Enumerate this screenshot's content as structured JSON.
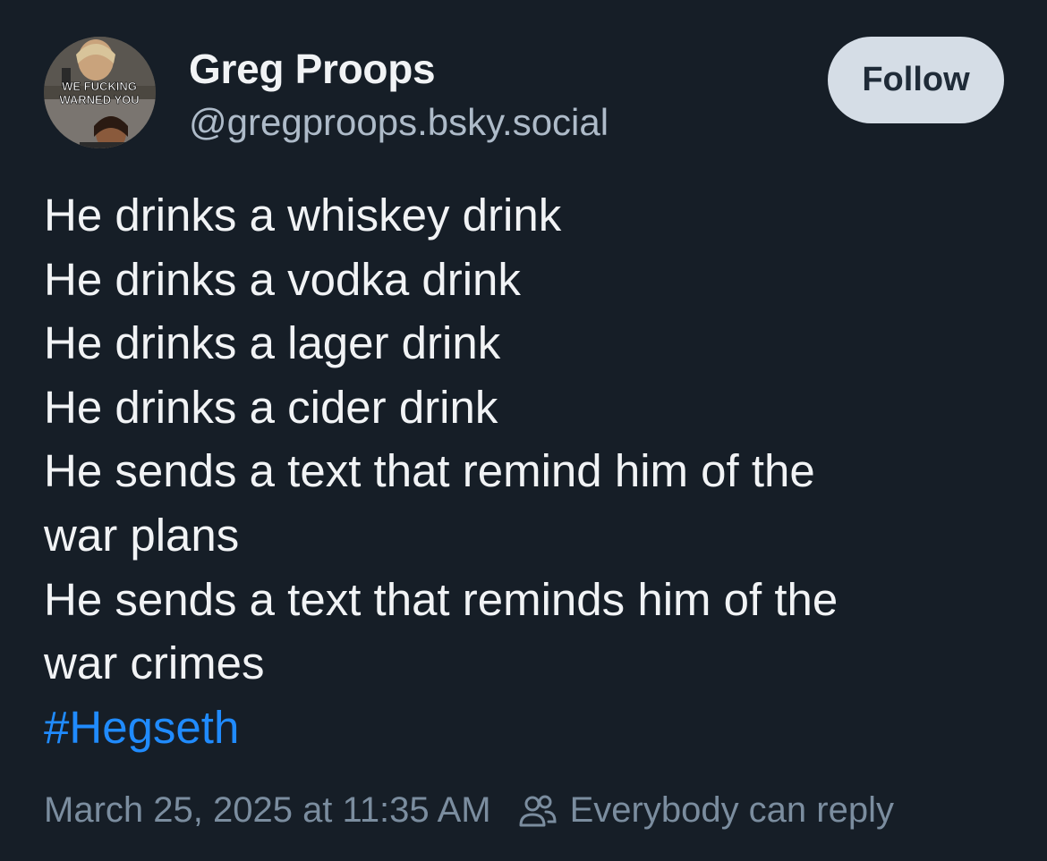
{
  "author": {
    "display_name": "Greg Proops",
    "handle": "@gregproops.bsky.social",
    "avatar_caption": "WE FUCKING WARNED YOU"
  },
  "follow_label": "Follow",
  "post": {
    "lines": [
      "He drinks a whiskey drink",
      "He drinks a vodka drink",
      "He drinks a lager drink",
      "He drinks a cider drink",
      "He sends a text that remind him of the",
      "war plans",
      "He sends a text that reminds him of the",
      "war crimes"
    ],
    "hashtag": "#Hegseth"
  },
  "meta": {
    "timestamp": "March 25, 2025 at 11:35 AM",
    "reply_setting": "Everybody can reply",
    "reply_icon": "people-icon"
  },
  "colors": {
    "background": "#161e27",
    "hashtag": "#208bfe",
    "follow_bg": "#d5dde6",
    "muted": "#7b8d9f"
  }
}
